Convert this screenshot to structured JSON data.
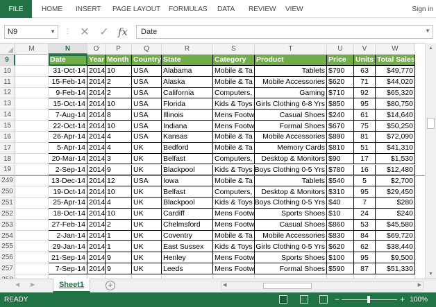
{
  "ribbon": {
    "file": "FILE",
    "tabs": [
      "HOME",
      "INSERT",
      "PAGE LAYOUT",
      "FORMULAS",
      "DATA",
      "REVIEW",
      "VIEW"
    ],
    "sign_in": "Sign in"
  },
  "formula_bar": {
    "name_box": "N9",
    "fx": "fx",
    "value": "Date"
  },
  "grid": {
    "columns": [
      "M",
      "N",
      "O",
      "P",
      "Q",
      "R",
      "S",
      "T",
      "U",
      "V",
      "W"
    ],
    "active_column": "N",
    "active_row": "9",
    "header_row_number": "9",
    "headers": [
      "Date",
      "Year",
      "Month",
      "Country",
      "State",
      "Category",
      "Product",
      "Price",
      "Units",
      "Total Sales"
    ],
    "rows": [
      {
        "n": "10",
        "cells": [
          "31-Oct-14",
          "2014",
          "10",
          "USA",
          "Alabama",
          "Mobile & Ta",
          "Tablets",
          "$790",
          "63",
          "$49,770"
        ]
      },
      {
        "n": "11",
        "cells": [
          "15-Feb-14",
          "2014",
          "2",
          "USA",
          "Alaska",
          "Mobile & Ta",
          "Mobile Accessories",
          "$620",
          "71",
          "$44,020"
        ]
      },
      {
        "n": "12",
        "cells": [
          "9-Feb-14",
          "2014",
          "2",
          "USA",
          "California",
          "Computers,",
          "Gaming",
          "$710",
          "92",
          "$65,320"
        ]
      },
      {
        "n": "13",
        "cells": [
          "15-Oct-14",
          "2014",
          "10",
          "USA",
          "Florida",
          "Kids & Toys",
          "Girls Clothing 6-8 Yrs",
          "$850",
          "95",
          "$80,750"
        ]
      },
      {
        "n": "14",
        "cells": [
          "7-Aug-14",
          "2014",
          "8",
          "USA",
          "Illinois",
          "Mens Footw",
          "Casual Shoes",
          "$240",
          "61",
          "$14,640"
        ]
      },
      {
        "n": "15",
        "cells": [
          "22-Oct-14",
          "2014",
          "10",
          "USA",
          "Indiana",
          "Mens Footw",
          "Formal Shoes",
          "$670",
          "75",
          "$50,250"
        ]
      },
      {
        "n": "16",
        "cells": [
          "26-Apr-14",
          "2014",
          "4",
          "USA",
          "Kansas",
          "Mobile & Ta",
          "Mobile Accessories",
          "$890",
          "81",
          "$72,090"
        ]
      },
      {
        "n": "17",
        "cells": [
          "5-Apr-14",
          "2014",
          "4",
          "UK",
          "Bedford",
          "Mobile & Ta",
          "Memory Cards",
          "$810",
          "51",
          "$41,310"
        ]
      },
      {
        "n": "18",
        "cells": [
          "20-Mar-14",
          "2014",
          "3",
          "UK",
          "Belfast",
          "Computers,",
          "Desktop & Monitors",
          "$90",
          "17",
          "$1,530"
        ]
      },
      {
        "n": "19",
        "cells": [
          "2-Sep-14",
          "2014",
          "9",
          "UK",
          "Blackpool",
          "Kids & Toys",
          "Boys Clothing 0-5 Yrs",
          "$780",
          "16",
          "$12,480"
        ]
      },
      {
        "n": "249",
        "cells": [
          "13-Dec-14",
          "2014",
          "12",
          "USA",
          "Iowa",
          "Mobile & Ta",
          "Tablets",
          "$540",
          "5",
          "$2,700"
        ]
      },
      {
        "n": "250",
        "cells": [
          "19-Oct-14",
          "2014",
          "10",
          "UK",
          "Belfast",
          "Computers,",
          "Desktop & Monitors",
          "$310",
          "95",
          "$29,450"
        ]
      },
      {
        "n": "251",
        "cells": [
          "25-Apr-14",
          "2014",
          "4",
          "UK",
          "Blackpool",
          "Kids & Toys",
          "Boys Clothing 0-5 Yrs",
          "$40",
          "7",
          "$280"
        ]
      },
      {
        "n": "252",
        "cells": [
          "18-Oct-14",
          "2014",
          "10",
          "UK",
          "Cardiff",
          "Mens Footw",
          "Sports Shoes",
          "$10",
          "24",
          "$240"
        ]
      },
      {
        "n": "253",
        "cells": [
          "27-Feb-14",
          "2014",
          "2",
          "UK",
          "Chelmsford",
          "Mens Footw",
          "Casual Shoes",
          "$860",
          "53",
          "$45,580"
        ]
      },
      {
        "n": "254",
        "cells": [
          "2-Jan-14",
          "2014",
          "1",
          "UK",
          "Coventry",
          "Mobile & Ta",
          "Mobile Accessories",
          "$830",
          "84",
          "$69,720"
        ]
      },
      {
        "n": "255",
        "cells": [
          "29-Jan-14",
          "2014",
          "1",
          "UK",
          "East Sussex",
          "Kids & Toys",
          "Girls Clothing 0-5 Yrs",
          "$620",
          "62",
          "$38,440"
        ]
      },
      {
        "n": "256",
        "cells": [
          "21-Sep-14",
          "2014",
          "9",
          "UK",
          "Henley",
          "Mens Footw",
          "Sports Shoes",
          "$100",
          "95",
          "$9,500"
        ]
      },
      {
        "n": "257",
        "cells": [
          "7-Sep-14",
          "2014",
          "9",
          "UK",
          "Leeds",
          "Mens Footw",
          "Formal Shoes",
          "$590",
          "87",
          "$51,330"
        ]
      }
    ],
    "trailing_row": "258"
  },
  "sheet_tabs": {
    "active": "Sheet1",
    "add_label": "+"
  },
  "status_bar": {
    "ready": "READY",
    "zoom_minus": "−",
    "zoom_plus": "+",
    "zoom": "100%"
  },
  "colors": {
    "excel_green": "#217346",
    "header_fill": "#70ad47"
  }
}
